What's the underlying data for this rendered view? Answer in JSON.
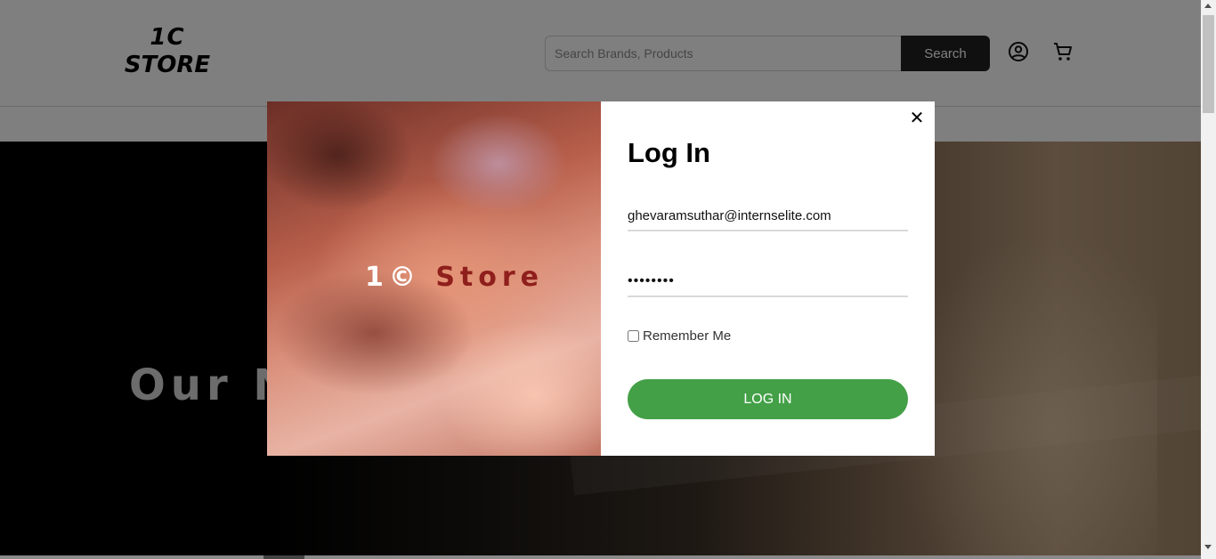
{
  "header": {
    "logo_line1": "1C",
    "logo_line2": "STORE",
    "search_placeholder": "Search Brands, Products",
    "search_button": "Search",
    "icons": [
      "account-circle-icon",
      "cart-icon"
    ]
  },
  "hero": {
    "title": "Our N"
  },
  "modal": {
    "brand_part1": "1©",
    "brand_part2": "Store",
    "title": "Log In",
    "email_value": "ghevaramsuthar@internselite.com",
    "password_value": "••••••••",
    "remember_label": "Remember Me",
    "login_button": "LOG IN",
    "close_symbol": "✕"
  },
  "colors": {
    "login_button": "#43a047",
    "search_button": "#212121",
    "brand_accent": "#8f1f1c"
  }
}
